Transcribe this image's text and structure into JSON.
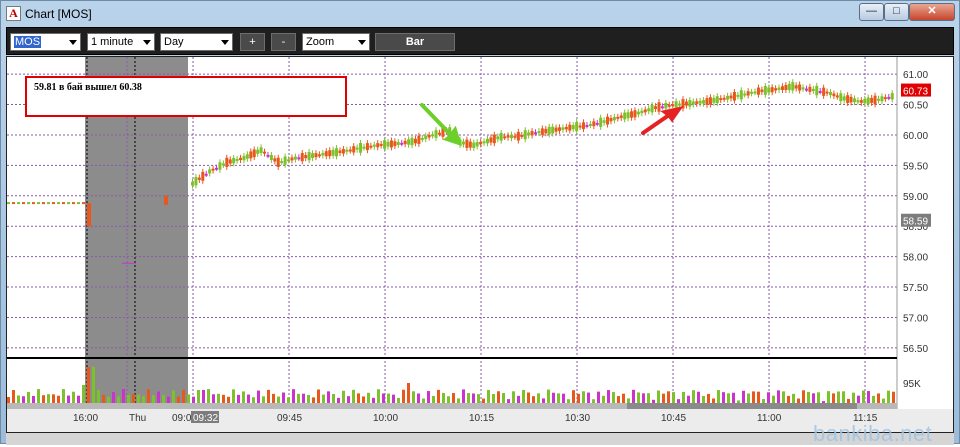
{
  "window": {
    "title": "Chart [MOS]",
    "app_icon_letter": "A"
  },
  "toolbar": {
    "symbol": "MOS",
    "interval": "1 minute",
    "range": "Day",
    "plus_label": "+",
    "minus_label": "-",
    "zoom_label": "Zoom",
    "bar_label": "Bar"
  },
  "annotation": {
    "text": "59.81 в бай вышел 60.38"
  },
  "chart_data": {
    "type": "candlestick",
    "symbol": "MOS",
    "price_axis": {
      "min": 56.5,
      "max": 61.0,
      "ticks": [
        "61.00",
        "60.50",
        "60.00",
        "59.50",
        "59.00",
        "58.50",
        "58.00",
        "57.50",
        "57.00",
        "56.50"
      ],
      "current_price_label": "60.73",
      "current_price_value": 60.73,
      "prev_close_label": "58.59",
      "prev_close_value": 58.59
    },
    "volume_axis": {
      "tick": "95K"
    },
    "time_axis": [
      "16:00",
      "Thu",
      "09:00",
      "09:32",
      "09:45",
      "10:00",
      "10:15",
      "10:30",
      "10:45",
      "11:00",
      "11:15"
    ],
    "colors": {
      "up": "#7dc12b",
      "down": "#e8581b",
      "flat": "#cc33cc",
      "grid": "#8a5aa8",
      "annotation_box": "#e00000",
      "arrow_green": "#6ccf2a",
      "arrow_red": "#e52222",
      "current_price_bg": "#e00000"
    },
    "prev_session_price": 58.88,
    "session_open": 59.1,
    "gap_bars": [
      58.85,
      59.0
    ],
    "path_points": [
      [
        0,
        59.2
      ],
      [
        5,
        59.4
      ],
      [
        10,
        59.55
      ],
      [
        15,
        59.62
      ],
      [
        20,
        59.75
      ],
      [
        25,
        59.55
      ],
      [
        30,
        59.62
      ],
      [
        35,
        59.66
      ],
      [
        40,
        59.7
      ],
      [
        45,
        59.74
      ],
      [
        50,
        59.8
      ],
      [
        55,
        59.84
      ],
      [
        60,
        59.86
      ],
      [
        65,
        59.9
      ],
      [
        70,
        60.0
      ],
      [
        75,
        60.08
      ],
      [
        78,
        59.88
      ],
      [
        82,
        59.83
      ],
      [
        86,
        59.9
      ],
      [
        90,
        59.97
      ],
      [
        95,
        59.98
      ],
      [
        100,
        60.04
      ],
      [
        105,
        60.08
      ],
      [
        110,
        60.12
      ],
      [
        115,
        60.16
      ],
      [
        120,
        60.22
      ],
      [
        125,
        60.3
      ],
      [
        130,
        60.36
      ],
      [
        135,
        60.45
      ],
      [
        140,
        60.5
      ],
      [
        145,
        60.52
      ],
      [
        150,
        60.55
      ],
      [
        155,
        60.6
      ],
      [
        160,
        60.66
      ],
      [
        165,
        60.72
      ],
      [
        170,
        60.75
      ],
      [
        175,
        60.8
      ],
      [
        180,
        60.75
      ],
      [
        185,
        60.7
      ],
      [
        190,
        60.6
      ],
      [
        195,
        60.55
      ],
      [
        200,
        60.58
      ],
      [
        205,
        60.65
      ]
    ]
  }
}
